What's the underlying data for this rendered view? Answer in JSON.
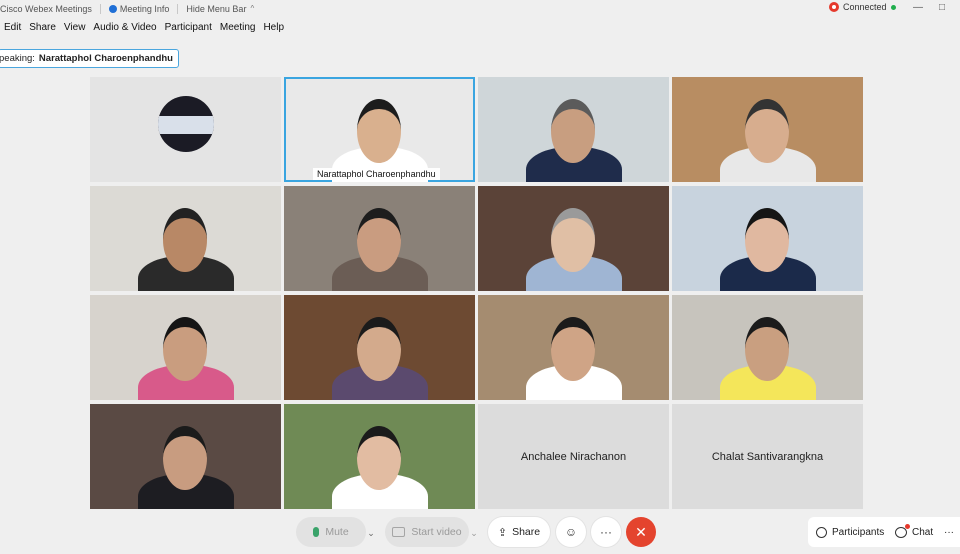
{
  "titlebar": {
    "app_name": "Cisco Webex Meetings",
    "meeting_info": "Meeting Info",
    "hide_menu_bar": "Hide Menu Bar",
    "connection_status": "Connected",
    "minimize": "—",
    "maximize": "□"
  },
  "menu": [
    "Edit",
    "Share",
    "View",
    "Audio & Video",
    "Participant",
    "Meeting",
    "Help"
  ],
  "speaking": {
    "prefix": "peaking:",
    "name": "Narattaphol Charoenphandhu"
  },
  "tiles": [
    {
      "type": "logo",
      "bg": "#e4e4e4"
    },
    {
      "type": "video",
      "name": "Narattaphol Charoenphandhu",
      "active": true,
      "bg": "#e9e9e9",
      "skin": "#d9b08e",
      "shirt": "#ffffff",
      "hair": "#1c1c1c"
    },
    {
      "type": "video",
      "bg": "#cfd6d9",
      "skin": "#c89e80",
      "shirt": "#1f2c4b",
      "hair": "#5b5b5b"
    },
    {
      "type": "video",
      "bg": "#b88d62",
      "skin": "#d7ad8e",
      "shirt": "#e8e8e8",
      "hair": "#333333"
    },
    {
      "type": "video",
      "bg": "#dcdad5",
      "skin": "#b88866",
      "shirt": "#2a2a2a",
      "hair": "#222222"
    },
    {
      "type": "video",
      "bg": "#8a8178",
      "skin": "#c99c80",
      "shirt": "#6b5d55",
      "hair": "#1d1d1d"
    },
    {
      "type": "video",
      "bg": "#5b4338",
      "skin": "#e0bfa5",
      "shirt": "#9fb5d3",
      "hair": "#9a9a9a"
    },
    {
      "type": "video",
      "bg": "#c8d3de",
      "skin": "#e0b8a0",
      "shirt": "#1b2a4a",
      "hair": "#151515"
    },
    {
      "type": "video",
      "bg": "#d7d3cd",
      "skin": "#c99d7f",
      "shirt": "#d85a8a",
      "hair": "#151515"
    },
    {
      "type": "video",
      "bg": "#6d4a32",
      "skin": "#d3aa8c",
      "shirt": "#5b4a6e",
      "hair": "#1b1b1b"
    },
    {
      "type": "video",
      "bg": "#a58c70",
      "skin": "#cfa486",
      "shirt": "#ffffff",
      "hair": "#1b1b1b"
    },
    {
      "type": "video",
      "bg": "#c7c4bd",
      "skin": "#c99f80",
      "shirt": "#f4e65a",
      "hair": "#1b1b1b"
    },
    {
      "type": "video",
      "bg": "#5a4a44",
      "skin": "#c89c80",
      "shirt": "#1d1d22",
      "hair": "#1b1b1b"
    },
    {
      "type": "video",
      "bg": "#6f8a55",
      "skin": "#e2bca2",
      "shirt": "#ffffff",
      "hair": "#1b1b1b"
    },
    {
      "type": "name",
      "name": "Anchalee Nirachanon",
      "bg": "#dcdcdc"
    },
    {
      "type": "name",
      "name": "Chalat Santivarangkna",
      "bg": "#dcdcdc"
    }
  ],
  "toolbar": {
    "mute": "Mute",
    "start_video": "Start video",
    "share": "Share",
    "reactions": "☺",
    "more": "···",
    "end": "✕",
    "participants": "Participants",
    "chat": "Chat",
    "overflow": "···"
  }
}
